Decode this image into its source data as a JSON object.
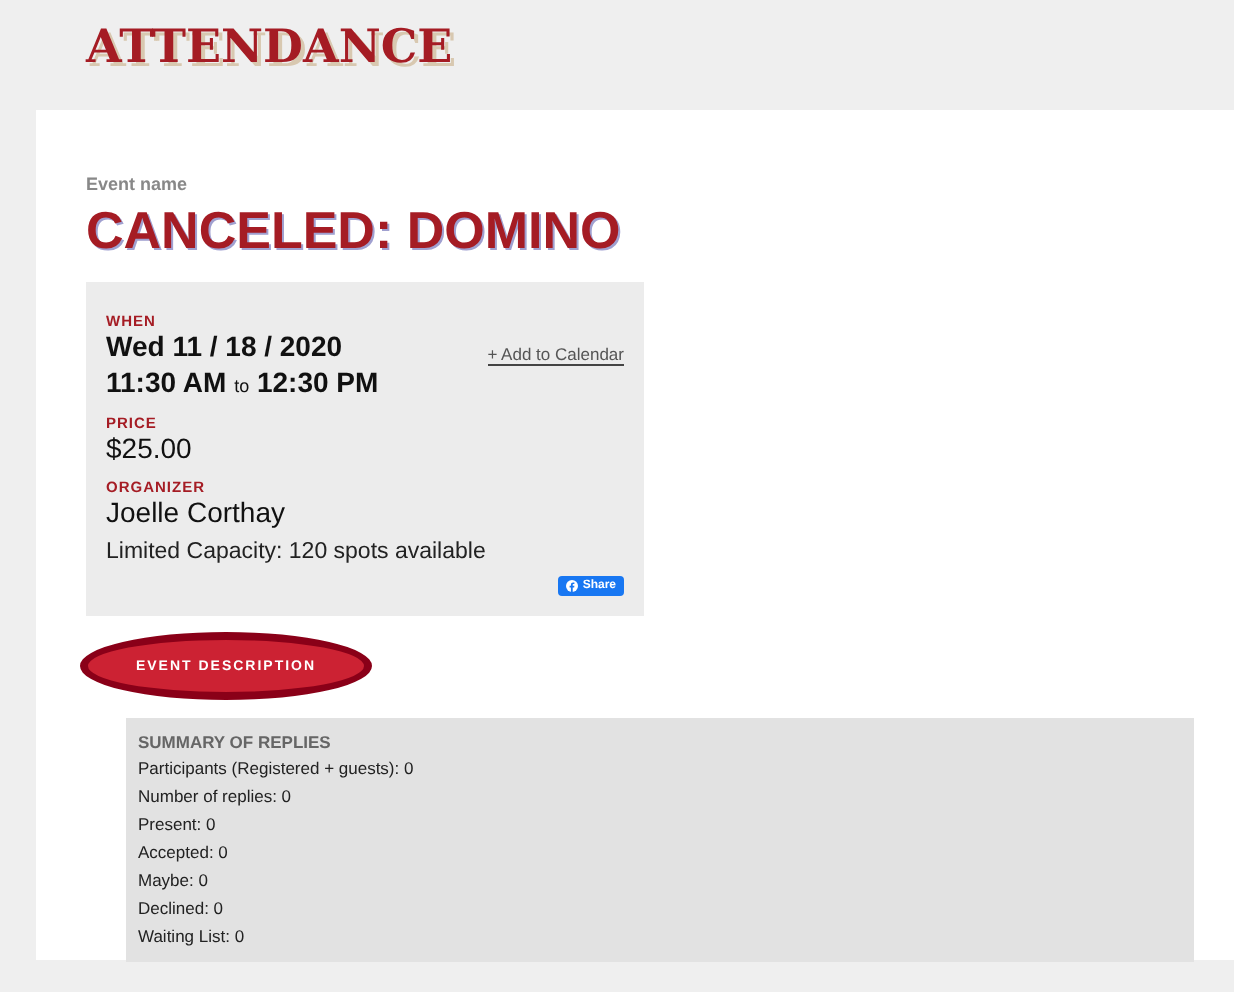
{
  "page_title": "ATTENDANCE",
  "event": {
    "name_label": "Event name",
    "name": "CANCELED: DOMINO"
  },
  "details": {
    "when_label": "WHEN",
    "date": "Wed 11 / 18 / 2020",
    "start": "11:30 AM",
    "to": "to",
    "end": "12:30 PM",
    "calendar_link": "+ Add to Calendar",
    "price_label": "PRICE",
    "price": "$25.00",
    "organizer_label": "ORGANIZER",
    "organizer": "Joelle Corthay",
    "capacity": "Limited Capacity: 120 spots available",
    "share_button": "Share"
  },
  "description_button": "EVENT DESCRIPTION",
  "summary": {
    "title": "SUMMARY OF REPLIES",
    "lines": [
      "Participants (Registered + guests): 0",
      "Number of replies: 0",
      "Present: 0",
      "Accepted: 0",
      "Maybe: 0",
      "Declined: 0",
      "Waiting List: 0"
    ]
  }
}
